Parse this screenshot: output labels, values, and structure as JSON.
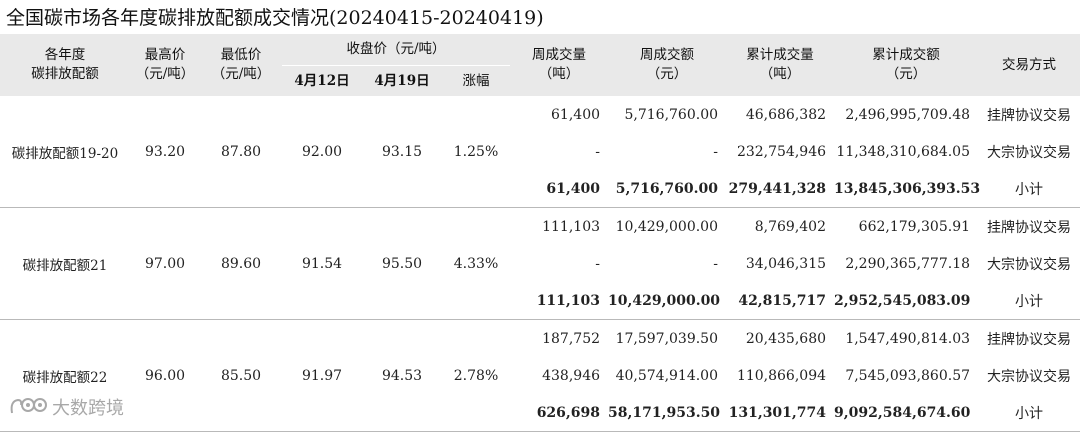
{
  "title": "全国碳市场各年度碳排放配额成交情况(20240415-20240419)",
  "headers": {
    "product": [
      "各年度",
      "碳排放配额"
    ],
    "high": [
      "最高价",
      "（元/吨）"
    ],
    "low": [
      "最低价",
      "（元/吨）"
    ],
    "close": "收盘价（元/吨）",
    "close_prev": "4月12日",
    "close_curr": "4月19日",
    "change": "涨幅",
    "week_vol": [
      "周成交量",
      "（吨）"
    ],
    "week_amt": [
      "周成交额",
      "（元）"
    ],
    "cum_vol": [
      "累计成交量",
      "（吨）"
    ],
    "cum_amt": [
      "累计成交额",
      "（元）"
    ],
    "method": "交易方式"
  },
  "groups": [
    {
      "name": "碳排放配额19-20",
      "high": "93.20",
      "low": "87.80",
      "close_prev": "92.00",
      "close_curr": "93.15",
      "change": "1.25%",
      "rows": [
        {
          "week_vol": "61,400",
          "week_amt": "5,716,760.00",
          "cum_vol": "46,686,382",
          "cum_amt": "2,496,995,709.48",
          "method": "挂牌协议交易"
        },
        {
          "week_vol": "-",
          "week_amt": "-",
          "cum_vol": "232,754,946",
          "cum_amt": "11,348,310,684.05",
          "method": "大宗协议交易"
        },
        {
          "week_vol": "61,400",
          "week_amt": "5,716,760.00",
          "cum_vol": "279,441,328",
          "cum_amt": "13,845,306,393.53",
          "method": "小计"
        }
      ]
    },
    {
      "name": "碳排放配额21",
      "high": "97.00",
      "low": "89.60",
      "close_prev": "91.54",
      "close_curr": "95.50",
      "change": "4.33%",
      "rows": [
        {
          "week_vol": "111,103",
          "week_amt": "10,429,000.00",
          "cum_vol": "8,769,402",
          "cum_amt": "662,179,305.91",
          "method": "挂牌协议交易"
        },
        {
          "week_vol": "-",
          "week_amt": "-",
          "cum_vol": "34,046,315",
          "cum_amt": "2,290,365,777.18",
          "method": "大宗协议交易"
        },
        {
          "week_vol": "111,103",
          "week_amt": "10,429,000.00",
          "cum_vol": "42,815,717",
          "cum_amt": "2,952,545,083.09",
          "method": "小计"
        }
      ]
    },
    {
      "name": "碳排放配额22",
      "high": "96.00",
      "low": "85.50",
      "close_prev": "91.97",
      "close_curr": "94.53",
      "change": "2.78%",
      "rows": [
        {
          "week_vol": "187,752",
          "week_amt": "17,597,039.50",
          "cum_vol": "20,435,680",
          "cum_amt": "1,547,490,814.03",
          "method": "挂牌协议交易"
        },
        {
          "week_vol": "438,946",
          "week_amt": "40,574,914.00",
          "cum_vol": "110,866,094",
          "cum_amt": "7,545,093,860.57",
          "method": "大宗协议交易"
        },
        {
          "week_vol": "626,698",
          "week_amt": "58,171,953.50",
          "cum_vol": "131,301,774",
          "cum_amt": "9,092,584,674.60",
          "method": "小计"
        }
      ]
    }
  ],
  "watermark": {
    "text": "大数跨境",
    "icon": "logo-icon"
  }
}
